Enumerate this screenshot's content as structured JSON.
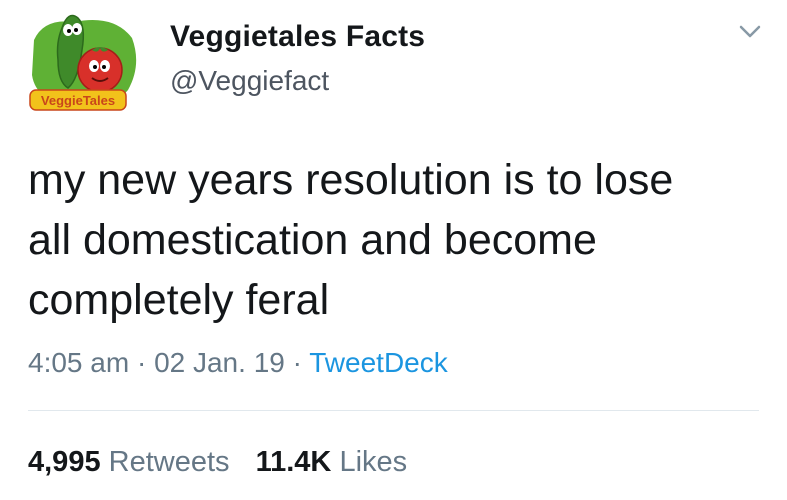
{
  "tweet": {
    "display_name": "Veggietales Facts",
    "handle": "@Veggiefact",
    "avatar_logo_text": "VeggieTales",
    "text_lines": [
      "my new years resolution is to lose",
      "all domestication and become",
      "completely feral"
    ],
    "time": "4:05 am",
    "date": "02 Jan. 19",
    "separator": "·",
    "source": "TweetDeck",
    "retweets_count": "4,995",
    "retweets_label": "Retweets",
    "likes_count": "11.4K",
    "likes_label": "Likes"
  },
  "colors": {
    "text": "#14171a",
    "muted": "#657786",
    "link": "#1b95e0",
    "divider": "#e1e8ed"
  },
  "icons": {
    "menu": "chevron-down-icon"
  }
}
